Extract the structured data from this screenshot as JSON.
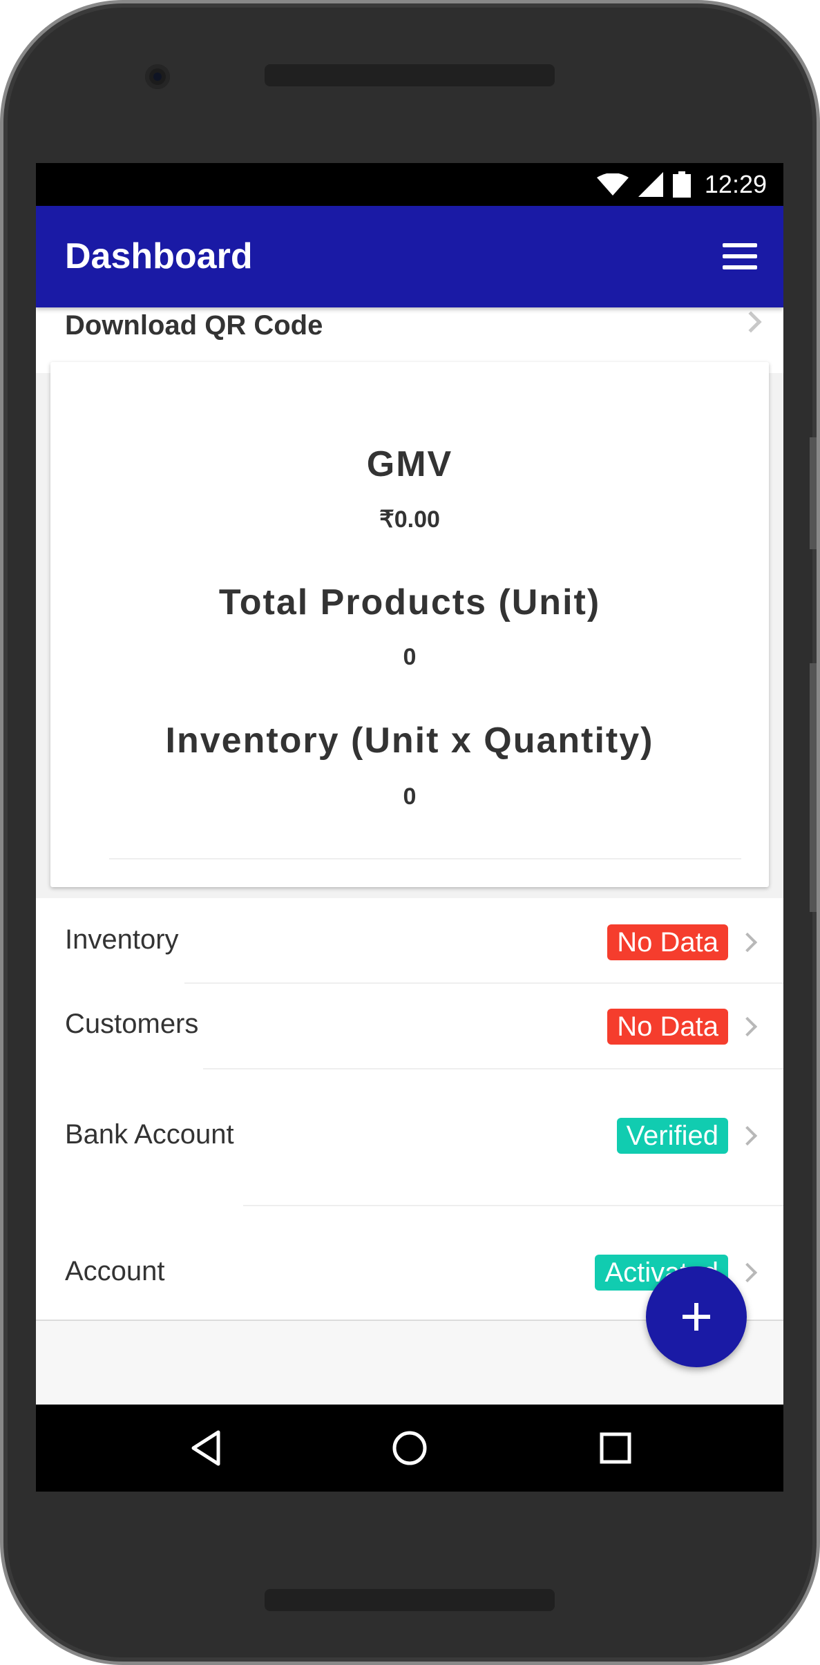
{
  "status_bar": {
    "time": "12:29",
    "icons": [
      "wifi-icon",
      "signal-icon",
      "battery-icon"
    ]
  },
  "app_bar": {
    "title": "Dashboard",
    "menu_icon": "hamburger-menu-icon"
  },
  "partial_row": {
    "label": "Download QR Code"
  },
  "summary_card": {
    "gmv_title": "GMV",
    "gmv_value": "₹0.00",
    "products_title": "Total Products (Unit)",
    "products_value": "0",
    "inventory_title": "Inventory (Unit x Quantity)",
    "inventory_value": "0"
  },
  "list": {
    "items": [
      {
        "label": "Inventory",
        "badge": "No Data",
        "badge_color": "#f53d2d"
      },
      {
        "label": "Customers",
        "badge": "No Data",
        "badge_color": "#f53d2d"
      },
      {
        "label": "Bank Account",
        "badge": "Verified",
        "badge_color": "#11ccb0"
      },
      {
        "label": "Account",
        "badge": "Activated",
        "badge_color": "#11ccb0"
      }
    ]
  },
  "fab": {
    "icon": "plus-icon"
  },
  "nav_bar": {
    "icons": [
      "back-icon",
      "home-icon",
      "recent-apps-icon"
    ]
  },
  "colors": {
    "primary": "#1a1aa5",
    "badge_red": "#f53d2d",
    "badge_teal": "#11ccb0"
  }
}
